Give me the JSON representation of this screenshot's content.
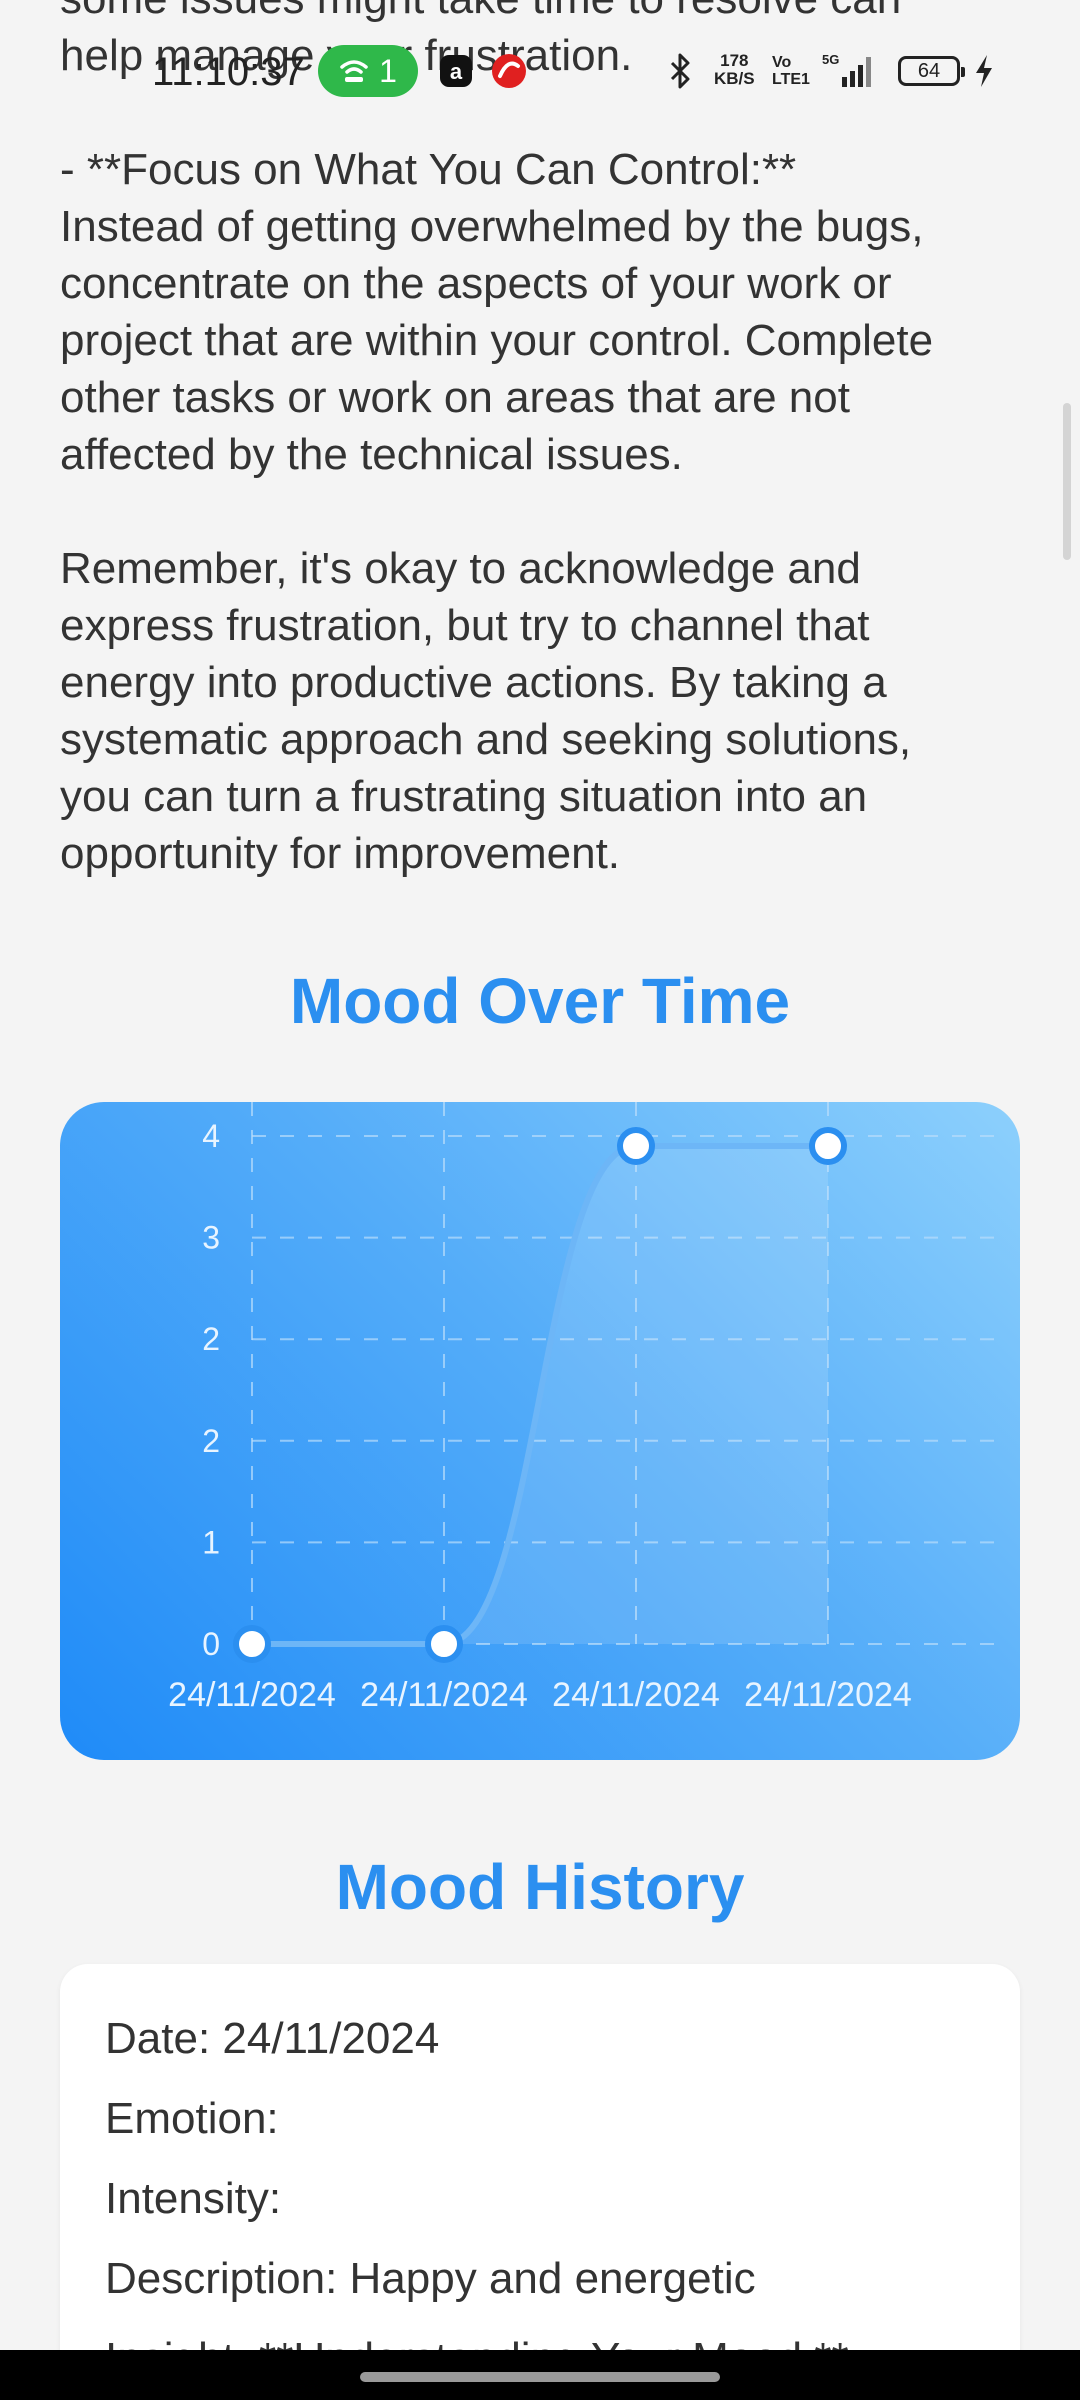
{
  "status_bar": {
    "time": "11:10:37",
    "hotspot_count": "1",
    "network_speed_value": "178",
    "network_speed_unit": "KB/S",
    "volte_top": "Vo",
    "volte_bottom": "LTE1",
    "signal_label": "5G",
    "battery_level": "64"
  },
  "article": {
    "partial_line_1": "some issues might take time to resolve can",
    "partial_line_2": "help manage your frustration.",
    "focus_paragraph": "- **Focus on What You Can Control:**\nInstead of getting overwhelmed by the bugs,\nconcentrate on the aspects of your work or\nproject that are within your control. Complete\nother tasks or work on areas that are not\naffected by the technical issues.",
    "closing_paragraph": "Remember, it's okay to acknowledge and\nexpress frustration, but try to channel that\nenergy into productive actions. By taking a\nsystematic approach and seeking solutions,\nyou can turn a frustrating situation into an\nopportunity for improvement."
  },
  "mood_chart_title": "Mood Over Time",
  "chart_data": {
    "type": "line",
    "x": [
      "24/11/2024",
      "24/11/2024",
      "24/11/2024",
      "24/11/2024"
    ],
    "values": [
      0,
      0,
      5,
      5
    ],
    "y_tick_labels": [
      "0",
      "1",
      "2",
      "2",
      "3",
      "4"
    ],
    "ylim": [
      0,
      5
    ],
    "grid": true,
    "curved": true,
    "colors": {
      "line": "#6db6f7",
      "point_fill": "#ffffff",
      "point_stroke": "#2b8ff0",
      "grid": "#b9ddfb",
      "labels": "#e8f4ff"
    }
  },
  "mood_history_title": "Mood History",
  "history": {
    "date": "Date: 24/11/2024",
    "emotion": "Emotion:",
    "intensity": "Intensity:",
    "description": "Description: Happy and energetic",
    "insight_partial": "Insight: **Understanding Your Mood:**"
  },
  "colors": {
    "accent": "#2b8ff0",
    "background": "#f4f4f4",
    "hotspot": "#2fb84a"
  }
}
